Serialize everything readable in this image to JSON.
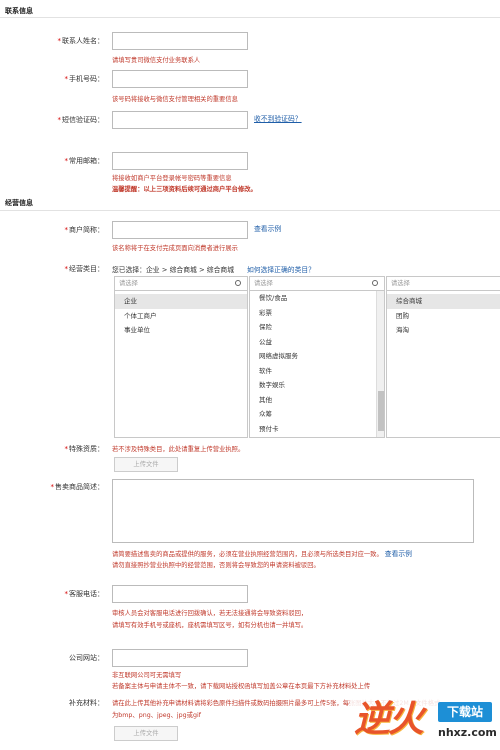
{
  "sections": {
    "contact": "联系信息",
    "business": "经营信息"
  },
  "contact": {
    "name": {
      "label": "联系人姓名：",
      "value": "",
      "hint": "请填写贵司微信支付业务联系人"
    },
    "phone": {
      "label": "手机号码：",
      "value": "",
      "hint": "该号码将接收与微信支付管理相关的重要信息"
    },
    "sms": {
      "label": "短信验证码：",
      "value": "",
      "link": "收不到验证码？"
    },
    "email": {
      "label": "常用邮箱：",
      "value": "",
      "hint": "将接收如商户平台登录帐号密码等重要信息",
      "warning": "温馨提醒：以上三项资料后续可通过商户平台修改。"
    }
  },
  "business": {
    "shortname": {
      "label": "商户简称：",
      "value": "",
      "link": "查看示例",
      "hint": "该名称将于在支付完成页面向消费者进行展示"
    },
    "category": {
      "label": "经营类目：",
      "selected_text": "您已选择：企业 > 综合商城 > 综合商城",
      "link": "如何选择正确的类目？",
      "placeholder": "请选择",
      "col1": [
        "企业",
        "个体工商户",
        "事业单位"
      ],
      "col2": [
        "餐饮/食品",
        "彩票",
        "保险",
        "公益",
        "网络虚拟服务",
        "软件",
        "数字娱乐",
        "其他",
        "众筹",
        "预付卡"
      ],
      "col3": [
        "综合商城",
        "团购",
        "海淘"
      ]
    },
    "special": {
      "label": "特殊资质：",
      "hint": "若不涉及特殊类目，此处请重复上传营业执照。",
      "button": "上传文件"
    },
    "description": {
      "label": "售卖商品简述：",
      "value": "",
      "hint1": "请简要描述售卖的商品或提供的服务，必须在营业执照经营范围内，且必须与所选类目对应一致。",
      "hint1_link": "查看示例",
      "hint2": "请勿直接照抄营业执照中的经营范围，否则将会导致您的申请资料被驳回。"
    },
    "service_phone": {
      "label": "客服电话：",
      "value": "",
      "hint1": "审核人员会对客服电话进行回拨确认，若无法接通将会导致资料驳回，",
      "hint2": "请填写有效手机号或座机，座机需填写区号，如有分机也请一并填写。"
    },
    "website": {
      "label": "公司网站：",
      "value": "",
      "hint1": "非互联网公司可无需填写",
      "hint2": "若备案主体与申请主体不一致，请下载网站授权函填写加盖公章在本页最下方补充材料处上传"
    },
    "supplement": {
      "label": "补充材料：",
      "hint1": "请在此上传其他补充申请材料请将彩色原件扫描件或数码拍摄照片最多可上传5张，每张图片大小不超过2M，文件格式",
      "hint2": "为bmp、png、jpeg、jpg或gif",
      "button": "上传文件"
    }
  },
  "watermark": {
    "text1": "逆火",
    "text2": "下载站",
    "text3": "nhxz.com"
  }
}
